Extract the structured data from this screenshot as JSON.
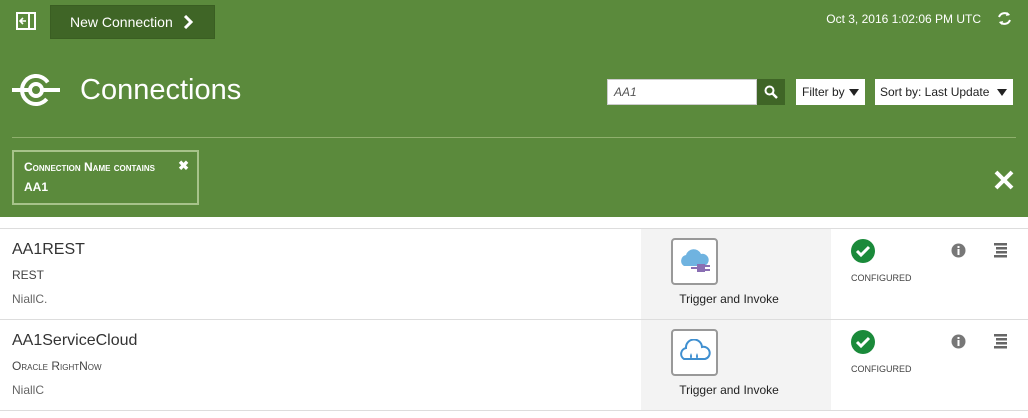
{
  "toolbar": {
    "new_connection_label": "New Connection",
    "timestamp": "Oct 3, 2016 1:02:06 PM UTC"
  },
  "page": {
    "title": "Connections"
  },
  "search": {
    "value": "AA1",
    "placeholder": ""
  },
  "filters": {
    "filter_label": "Filter by",
    "sort_label": "Sort by: Last Update",
    "active_chip": {
      "label": "Connection Name contains",
      "value": "AA1"
    }
  },
  "connections": [
    {
      "name": "AA1REST",
      "type": "REST",
      "owner": "NiallC.",
      "role": "Trigger and Invoke",
      "status": "CONFIGURED",
      "icon": "rest-cloud-plug-icon"
    },
    {
      "name": "AA1ServiceCloud",
      "type": "Oracle RightNow",
      "owner": "NiallC",
      "role": "Trigger and Invoke",
      "status": "CONFIGURED",
      "icon": "rightnow-cloud-icon"
    }
  ],
  "colors": {
    "header_bg": "#5b8a3c",
    "button_dark": "#3f6526",
    "status_ok": "#1a8a3a"
  }
}
